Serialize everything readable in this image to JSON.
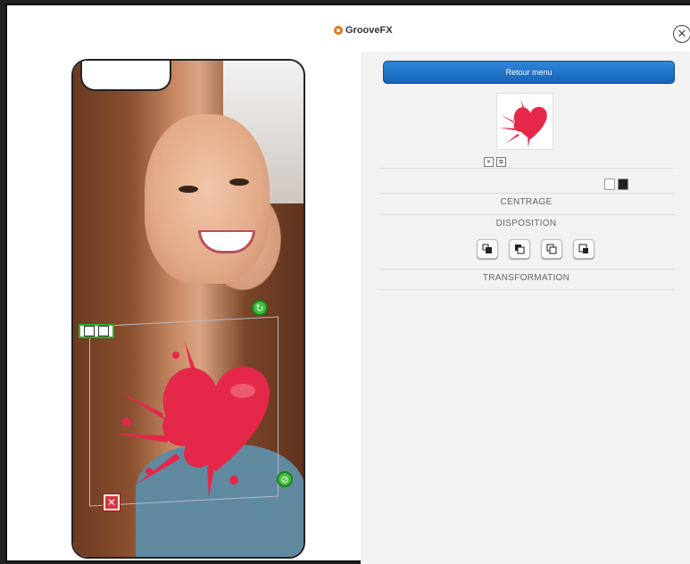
{
  "app": {
    "logo_text": "GrooveFX"
  },
  "panel": {
    "back_label": "Retour menu",
    "sections": {
      "centrage": "CENTRAGE",
      "disposition": "DISPOSITION",
      "transformation": "TRANSFORMATION"
    },
    "mini_tools": [
      {
        "label": "✕"
      },
      {
        "label": "⧉"
      }
    ],
    "disposition_buttons": [
      {
        "name": "bring-to-front-icon"
      },
      {
        "name": "bring-forward-icon"
      },
      {
        "name": "send-backward-icon"
      },
      {
        "name": "send-to-back-icon"
      }
    ]
  },
  "colors": {
    "accent": "#1e76cf",
    "handle_green": "#3fbf3f",
    "delete_red": "#d9343e",
    "heart": "#e5284a"
  },
  "icons": {
    "close": "close-icon",
    "rotate": "rotate-icon",
    "delete": "delete-icon",
    "resize": "resize-icon",
    "flip": "flip-icon"
  }
}
